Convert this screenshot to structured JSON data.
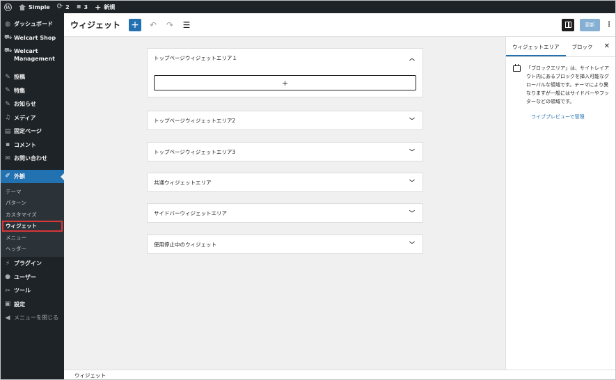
{
  "admin_bar": {
    "site_name": "Simple",
    "updates_count": "2",
    "comments_count": "3",
    "new_label": "新規"
  },
  "sidebar": {
    "items": [
      {
        "label": "ダッシュボード",
        "icon": "dashboard-icon"
      },
      {
        "label": "Welcart Shop",
        "icon": "cart-icon"
      },
      {
        "label": "Welcart Management",
        "icon": "cart-icon"
      },
      {
        "label": "投稿",
        "icon": "pin-icon"
      },
      {
        "label": "特集",
        "icon": "pin-icon"
      },
      {
        "label": "お知らせ",
        "icon": "pin-icon"
      },
      {
        "label": "メディア",
        "icon": "media-icon"
      },
      {
        "label": "固定ページ",
        "icon": "page-icon"
      },
      {
        "label": "コメント",
        "icon": "comment-icon"
      },
      {
        "label": "お問い合わせ",
        "icon": "mail-icon"
      },
      {
        "label": "外観",
        "icon": "brush-icon"
      }
    ],
    "submenu": [
      "テーマ",
      "パターン",
      "カスタマイズ",
      "ウィジェット",
      "メニュー",
      "ヘッダー"
    ],
    "items_after": [
      {
        "label": "プラグイン",
        "icon": "plugin-icon"
      },
      {
        "label": "ユーザー",
        "icon": "user-icon"
      },
      {
        "label": "ツール",
        "icon": "wrench-icon"
      },
      {
        "label": "設定",
        "icon": "settings-icon"
      }
    ],
    "collapse_label": "メニューを閉じる"
  },
  "header": {
    "title": "ウィジェット",
    "update_label": "更新"
  },
  "widget_areas": [
    {
      "label": "トップページウィジェットエリア１",
      "expanded": true
    },
    {
      "label": "トップページウィジェットエリア2",
      "expanded": false
    },
    {
      "label": "トップページウィジェットエリア3",
      "expanded": false
    },
    {
      "label": "共通ウィジェットエリア",
      "expanded": false
    },
    {
      "label": "サイドバーウィジェットエリア",
      "expanded": false
    },
    {
      "label": "使用停止中のウィジェット",
      "expanded": false
    }
  ],
  "appender_label": "+",
  "panel": {
    "tab_widget_area": "ウィジェットエリア",
    "tab_block": "ブロック",
    "description": "「ブロックエリア」は、サイトレイアウト内にあるブロックを挿入可能なグローバルな領域です。テーマにより異なりますが一般にはサイドバーやフッターなどの領域です。",
    "link": "ライブプレビューで管理"
  },
  "footer": {
    "breadcrumb": "ウィジェット"
  },
  "colors": {
    "accent": "#2271b1",
    "admin_dark": "#1d2327",
    "highlight_border": "#d63638"
  }
}
